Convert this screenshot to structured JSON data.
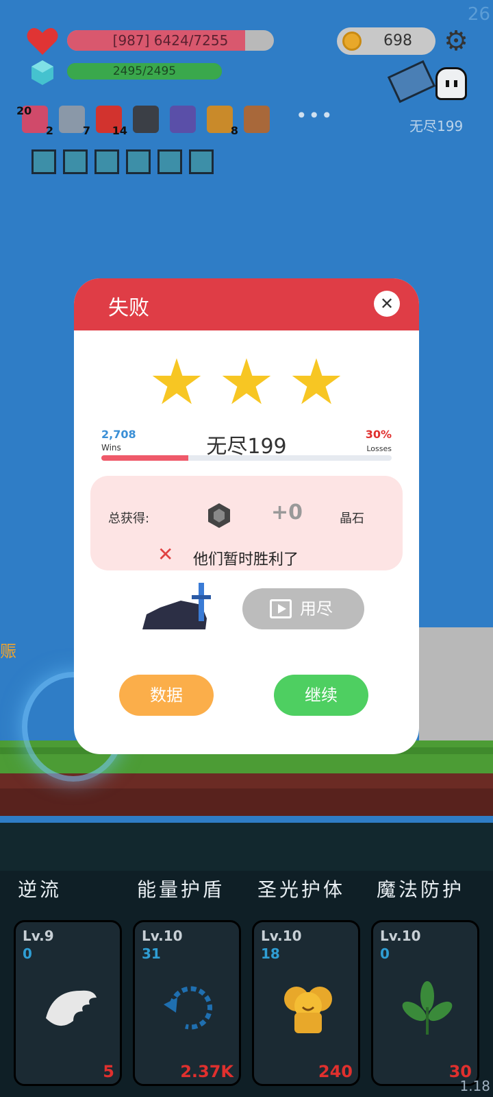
{
  "top": {
    "corner_number": "26",
    "version": "1.18"
  },
  "hud": {
    "hp_text": "[987] 6424/7255",
    "hp_fraction": 0.86,
    "mp_text": "2495/2495",
    "mp_fraction": 1.0,
    "coins": "698",
    "stage_label": "无尽199"
  },
  "inventory": [
    {
      "icon": "jam-jar-icon",
      "count_left": "20",
      "count": "2",
      "color": "#d04a6a"
    },
    {
      "icon": "sword-icon",
      "count": "7",
      "color": "#8a98a8"
    },
    {
      "icon": "apple-icon",
      "count": "14",
      "color": "#d2332e"
    },
    {
      "icon": "skull-book-icon",
      "count": "",
      "color": "#3b3f46"
    },
    {
      "icon": "wizard-hat-icon",
      "count": "",
      "color": "#5a4fa8"
    },
    {
      "icon": "gold-book-icon",
      "count": "8",
      "color": "#c98a2a"
    },
    {
      "icon": "meat-icon",
      "count": "",
      "color": "#a8683a"
    }
  ],
  "inventory_more": "•••",
  "buffs": [
    "buff-angel-icon",
    "buff-angel-icon",
    "buff-skull-icon",
    "buff-swirl-icon",
    "buff-swirl-icon",
    "buff-swirl-icon"
  ],
  "side_label": "赈",
  "dialog": {
    "title": "失败",
    "stars": [
      "★",
      "★",
      "★"
    ],
    "wins_number": "2,708",
    "wins_label": "Wins",
    "losses_number": "30%",
    "losses_label": "Losses",
    "stage_name": "无尽199",
    "progress_fraction": 0.3,
    "reward_label": "总获得:",
    "reward_value": "+0",
    "reward_unit": "晶石",
    "fail_mark": "✕",
    "fail_message": "他们暂时胜利了",
    "video_button": "用尽",
    "data_button": "数据",
    "continue_button": "继续",
    "close": "✕"
  },
  "skills": [
    {
      "title": "逆流",
      "level": "Lv.9",
      "value": "0",
      "cost": "5"
    },
    {
      "title": "能量护盾",
      "level": "Lv.10",
      "value": "31",
      "cost": "2.37K"
    },
    {
      "title": "圣光护体",
      "level": "Lv.10",
      "value": "18",
      "cost": "240"
    },
    {
      "title": "魔法防护",
      "level": "Lv.10",
      "value": "0",
      "cost": "30"
    }
  ],
  "colors": {
    "sky": "#2f7dc6",
    "dialog_header": "#df3d46",
    "star": "#f7c623",
    "continue": "#4ecf61",
    "data": "#fbae4a"
  }
}
